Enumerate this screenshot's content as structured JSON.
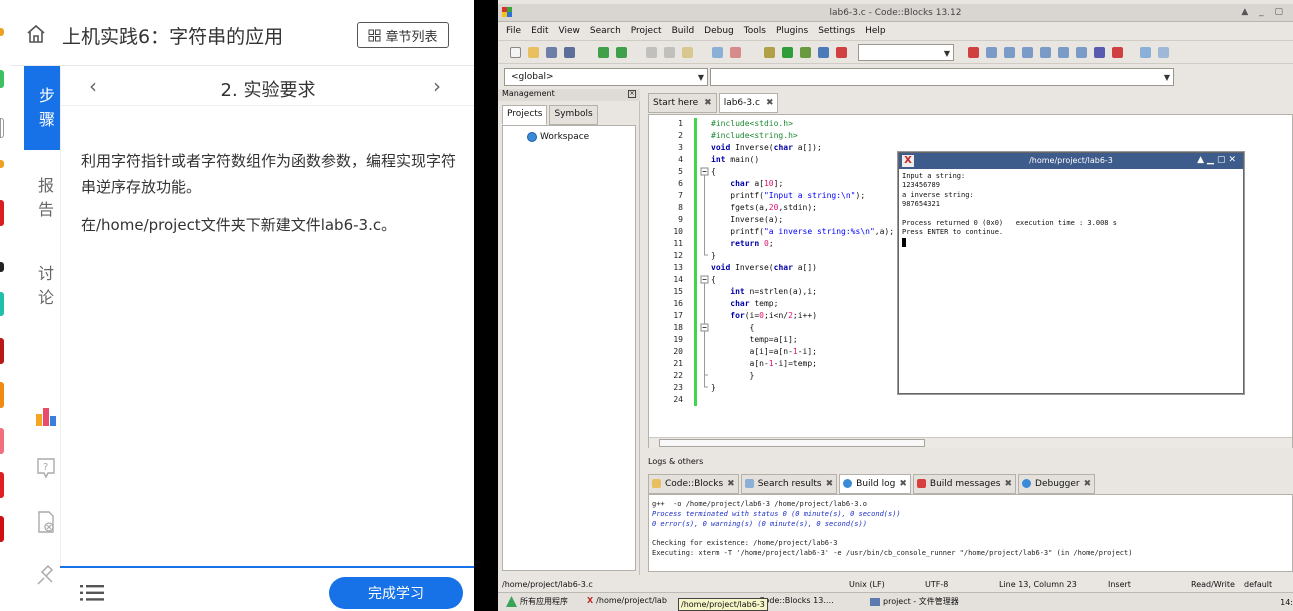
{
  "left_panel": {
    "title": "上机实践6：字符串的应用",
    "chapter_list_label": "章节列表",
    "nav": {
      "steps": "步骤",
      "report": "报告",
      "discuss": "讨论"
    },
    "step_title": "2. 实验要求",
    "paragraphs": [
      "利用字符指针或者字符数组作为函数参数，编程实现字符串逆序存放功能。",
      "在/home/project文件夹下新建文件lab6-3.c。"
    ],
    "complete_label": "完成学习",
    "colors": {
      "accent": "#1772e8"
    }
  },
  "ide": {
    "window_title": "lab6-3.c - Code::Blocks 13.12",
    "menu": [
      "File",
      "Edit",
      "View",
      "Search",
      "Project",
      "Build",
      "Debug",
      "Tools",
      "Plugins",
      "Settings",
      "Help"
    ],
    "scope_global": "<global>",
    "management": {
      "header": "Management",
      "tabs": [
        "Projects",
        "Symbols"
      ],
      "workspace": "Workspace"
    },
    "editor_tabs": [
      "Start here",
      "lab6-3.c"
    ],
    "line_numbers": [
      "1",
      "2",
      "3",
      "4",
      "5",
      "6",
      "7",
      "8",
      "9",
      "10",
      "11",
      "12",
      "13",
      "14",
      "15",
      "16",
      "17",
      "18",
      "19",
      "20",
      "21",
      "22",
      "23",
      "24"
    ],
    "code_lines": [
      "#include<stdio.h>",
      "#include<string.h>",
      "void Inverse(char a[]);",
      "int main()",
      "{",
      "    char a[10];",
      "    printf(\"Input a string:\\n\");",
      "    fgets(a,20,stdin);",
      "    Inverse(a);",
      "    printf(\"a inverse string:%s\\n\",a);",
      "    return 0;",
      "}",
      "void Inverse(char a[])",
      "{",
      "    int n=strlen(a),i;",
      "    char temp;",
      "    for(i=0;i<n/2;i++)",
      "        {",
      "        temp=a[i];",
      "        a[i]=a[n-1-i];",
      "        a[n-1-i]=temp;",
      "        }",
      "}",
      ""
    ],
    "terminal": {
      "title": "/home/project/lab6-3",
      "lines": [
        "Input a string:",
        "123456789",
        "a inverse string:",
        "987654321",
        "",
        "Process returned 0 (0x0)   execution time : 3.008 s",
        "Press ENTER to continue."
      ]
    },
    "logs": {
      "header": "Logs & others",
      "tabs": [
        "Code::Blocks",
        "Search results",
        "Build log",
        "Build messages",
        "Debugger"
      ],
      "lines": [
        {
          "text": "g++  -o /home/project/lab6-3 /home/project/lab6-3.o",
          "style": "normal"
        },
        {
          "text": "Process terminated with status 0 (0 minute(s), 0 second(s))",
          "style": "blue"
        },
        {
          "text": "0 error(s), 0 warning(s) (0 minute(s), 0 second(s))",
          "style": "blue"
        },
        {
          "text": "",
          "style": "normal"
        },
        {
          "text": "Checking for existence: /home/project/lab6-3",
          "style": "normal"
        },
        {
          "text": "Executing: xterm -T '/home/project/lab6-3' -e /usr/bin/cb_console_runner \"/home/project/lab6-3\" (in /home/project)",
          "style": "normal"
        }
      ]
    },
    "status": {
      "file": "/home/project/lab6-3.c",
      "eol": "Unix (LF)",
      "encoding": "UTF-8",
      "position": "Line 13, Column 23",
      "mode": "Insert",
      "access": "Read/Write",
      "profile": "default"
    },
    "taskbar": {
      "apps": "所有应用程序",
      "task1": "/home/project/lab",
      "tooltip": "/home/project/lab6-3",
      "task2": ".c - Code::Blocks 13.…",
      "task3": "project - 文件管理器",
      "clock": "14:"
    }
  }
}
